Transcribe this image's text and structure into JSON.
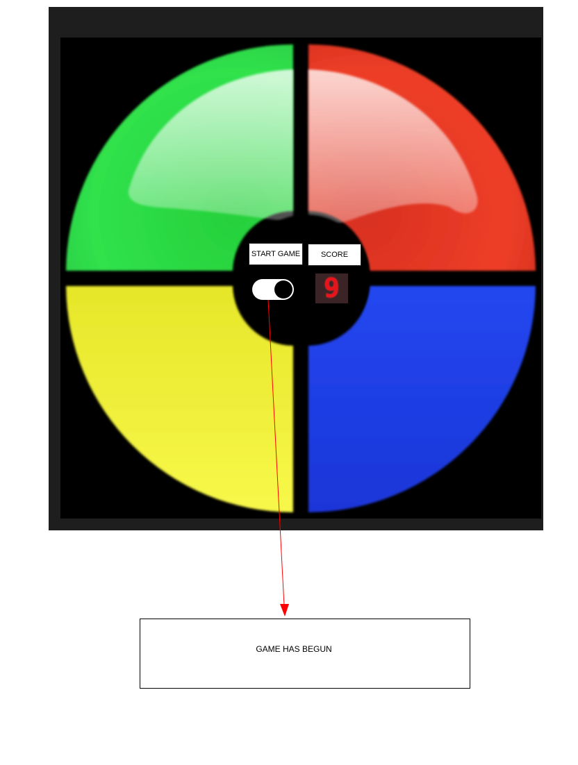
{
  "game": {
    "start_label": "START GAME",
    "score_label": "SCORE",
    "score_value": "9",
    "power_on": true,
    "colors": {
      "green": "#2fe04a",
      "red": "#e8341f",
      "yellow": "#ecec2c",
      "blue": "#1f3fe6",
      "frame": "#1e1e1e",
      "display_digit": "#e8141c"
    }
  },
  "annotation": {
    "message": "GAME HAS BEGUN",
    "arrow_color": "#ff0000"
  }
}
